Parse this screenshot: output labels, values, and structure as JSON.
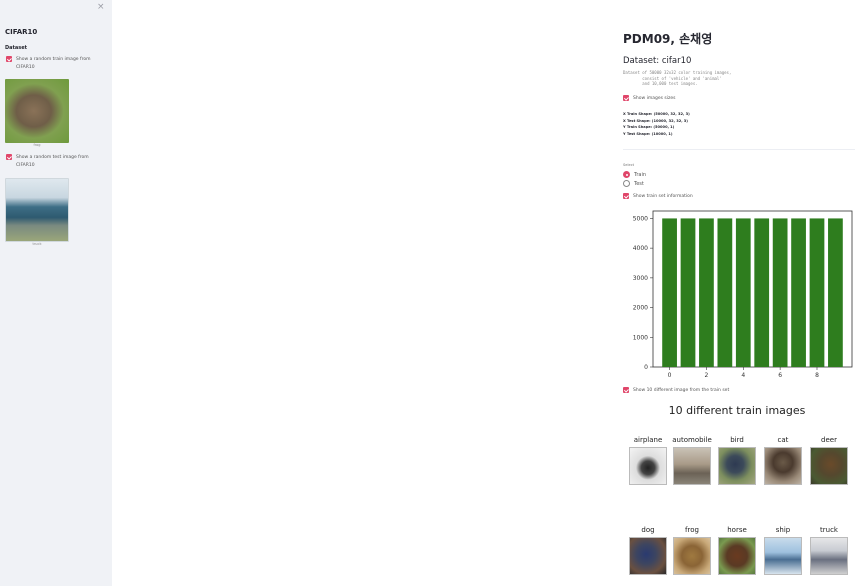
{
  "sidebar": {
    "close": "×",
    "title": "CIFAR10",
    "section": "Dataset",
    "train_checkbox": "Show a random train image from CIFAR10",
    "train_caption": "frog",
    "test_checkbox": "Show a random test image from CIFAR10",
    "test_caption": "truck"
  },
  "main": {
    "title": "PDM09, 손채영",
    "dataset_header": "Dataset: cifar10",
    "description": "Dataset of 50000 32x32 color training images,\n        consist of 'vehicle' and 'animal'\n        and 10,000 test images.",
    "show_sizes_label": "Show images sizes",
    "shapes": [
      "X Train Shape: (50000, 32, 32, 3)",
      "X Test Shape: (10000, 32, 32, 3)",
      "Y Train Shape: (50000, 1)",
      "Y Test Shape: (10000, 1)"
    ],
    "select_label": "Select",
    "radio_train": "Train",
    "radio_test": "Test",
    "show_info_label": "Show train set information",
    "show_10_label": "Show 10 different image from the train set",
    "fig_title": "10 different train images",
    "classes": [
      "airplane",
      "automobile",
      "bird",
      "cat",
      "deer",
      "dog",
      "frog",
      "horse",
      "ship",
      "truck"
    ]
  },
  "colors": {
    "accent": "#e0466a",
    "bar": "#2e7d1e",
    "sidebar_bg": "#f0f2f6"
  },
  "chart_data": {
    "type": "bar",
    "categories": [
      0,
      1,
      2,
      3,
      4,
      5,
      6,
      7,
      8,
      9
    ],
    "values": [
      5000,
      5000,
      5000,
      5000,
      5000,
      5000,
      5000,
      5000,
      5000,
      5000
    ],
    "xticks": [
      0,
      2,
      4,
      6,
      8
    ],
    "yticks": [
      0,
      1000,
      2000,
      3000,
      4000,
      5000
    ],
    "ylim": [
      0,
      5250
    ],
    "xlim": [
      -0.9,
      9.9
    ],
    "grid": false
  }
}
